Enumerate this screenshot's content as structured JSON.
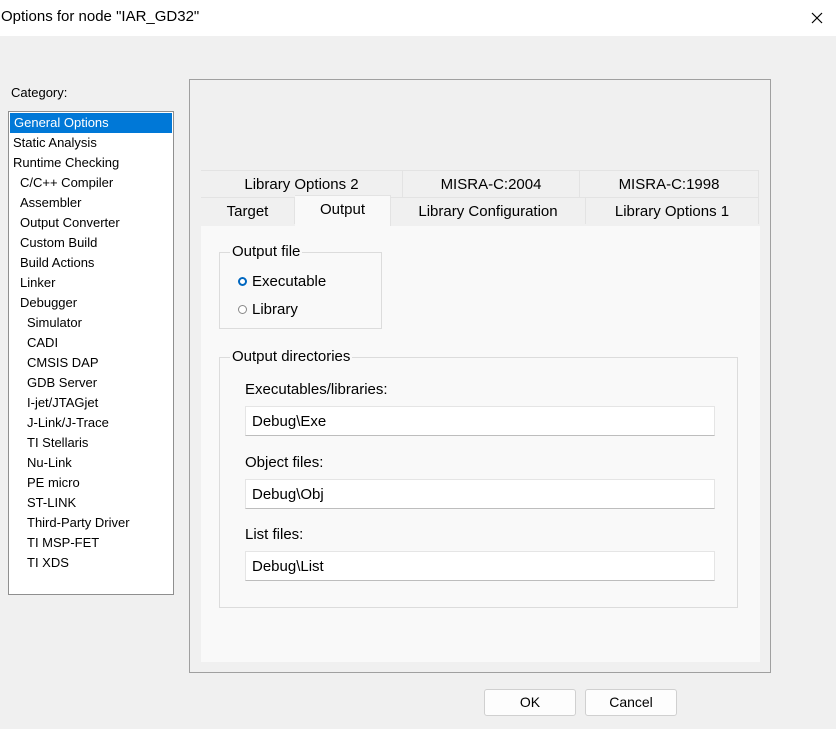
{
  "window": {
    "title": "Options for node \"IAR_GD32\"",
    "close_glyph": "✕"
  },
  "category": {
    "label": "Category:",
    "items": [
      {
        "label": "General Options",
        "selected": true
      },
      {
        "label": "Static Analysis"
      },
      {
        "label": "Runtime Checking"
      },
      {
        "label": "C/C++ Compiler"
      },
      {
        "label": "Assembler"
      },
      {
        "label": "Output Converter"
      },
      {
        "label": "Custom Build"
      },
      {
        "label": "Build Actions"
      },
      {
        "label": "Linker"
      },
      {
        "label": "Debugger"
      },
      {
        "label": "Simulator"
      },
      {
        "label": "CADI"
      },
      {
        "label": "CMSIS DAP"
      },
      {
        "label": "GDB Server"
      },
      {
        "label": "I-jet/JTAGjet"
      },
      {
        "label": "J-Link/J-Trace"
      },
      {
        "label": "TI Stellaris"
      },
      {
        "label": "Nu-Link"
      },
      {
        "label": "PE micro"
      },
      {
        "label": "ST-LINK"
      },
      {
        "label": "Third-Party Driver"
      },
      {
        "label": "TI MSP-FET"
      },
      {
        "label": "TI XDS"
      }
    ]
  },
  "tabs": {
    "row_back": [
      "Library Options 2",
      "MISRA-C:2004",
      "MISRA-C:1998"
    ],
    "row_front": [
      "Target",
      "Output",
      "Library Configuration",
      "Library Options 1"
    ],
    "active": "Output"
  },
  "output_file": {
    "legend": "Output file",
    "executable": "Executable",
    "library": "Library",
    "selected": "Executable"
  },
  "output_dirs": {
    "legend": "Output directories",
    "exe_label": "Executables/libraries:",
    "exe_value": "Debug\\Exe",
    "obj_label": "Object files:",
    "obj_value": "Debug\\Obj",
    "list_label": "List files:",
    "list_value": "Debug\\List"
  },
  "buttons": {
    "ok": "OK",
    "cancel": "Cancel"
  }
}
